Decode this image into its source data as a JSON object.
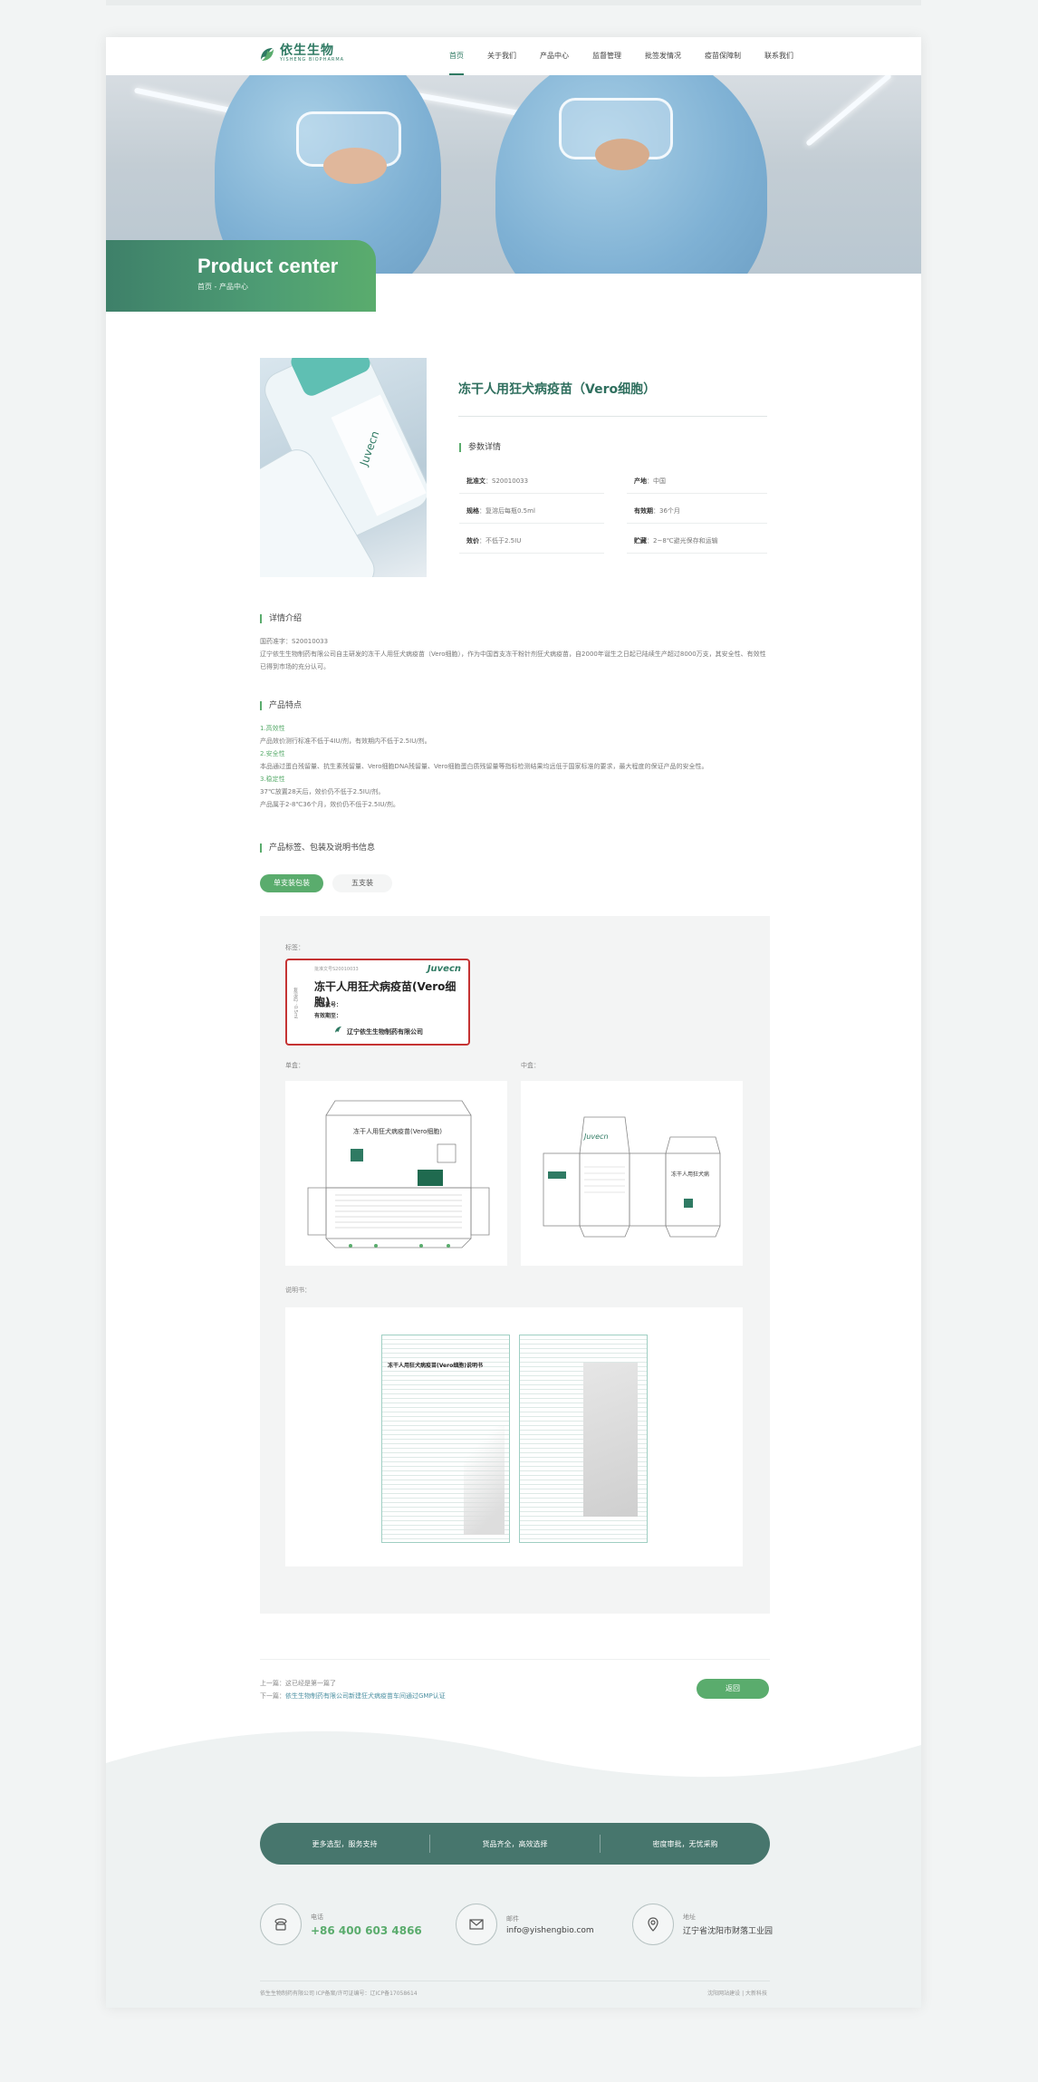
{
  "brand": {
    "name": "依生生物",
    "sub": "YISHENG BIOPHARMA"
  },
  "nav": [
    "首页",
    "关于我们",
    "产品中心",
    "监督管理",
    "批签发情况",
    "疫苗保障制",
    "联系我们"
  ],
  "banner": {
    "title": "Product center",
    "breadcrumb": "首页 - 产品中心"
  },
  "product": {
    "title": "冻干人用狂犬病疫苗（Vero细胞）",
    "params_heading": "参数详情",
    "specs": [
      {
        "label": "批准文",
        "value": "S20010033"
      },
      {
        "label": "产地",
        "value": "中国"
      },
      {
        "label": "规格",
        "value": "复溶后每瓶0.5ml"
      },
      {
        "label": "有效期",
        "value": "36个月"
      },
      {
        "label": "效价",
        "value": "不低于2.5IU"
      },
      {
        "label": "贮藏",
        "value": "2~8℃避光保存和运输"
      }
    ]
  },
  "detail": {
    "heading": "详情介绍",
    "lines": [
      "国药准字：S20010033",
      "辽宁依生生物制药有限公司自主研发的冻干人用狂犬病疫苗（Vero细胞），作为中国首支冻干粉针剂狂犬病疫苗，自2000年诞生之日起已陆续生产超过8000万支，其安全性、有效性已得到市场的充分认可。"
    ]
  },
  "features": {
    "heading": "产品特点",
    "lines": [
      "1.高效性",
      "产品效价测行标准不低于4IU/剂，有效期内不低于2.5IU/剂。",
      "2.安全性",
      "本品通过蛋白残留量、抗生素残留量、Vero细胞DNA残留量、Vero细胞蛋白质残留量等指标检测结果均远低于国家标准的要求，最大程度的保证产品的安全性。",
      "3.稳定性",
      "37℃放置28天后，效价仍不低于2.5IU/剂。",
      "产品属于2-8℃36个月，效价仍不低于2.5IU/剂。"
    ]
  },
  "packaging": {
    "heading": "产品标签、包装及说明书信息",
    "tabs": [
      "单支装包装",
      "五支装"
    ],
    "label_caption": "标签：",
    "single_box_caption": "单盒：",
    "mid_box_caption": "中盒：",
    "manual_caption": "说明书：",
    "label_card": {
      "approval": "批准文号S20010033",
      "name": "冻干人用狂犬病疫苗(Vero细胞)",
      "batch": "产品批号：",
      "expiry": "有效期至：",
      "company": "辽宁依生生物制药有限公司",
      "side": "复溶后：0.5ml",
      "logo": "Juvecn"
    },
    "manual_title": "冻干人用狂犬病疫苗(Vero细胞)说明书"
  },
  "pager": {
    "prev_label": "上一篇：",
    "prev_text": "这已经是第一篇了",
    "next_label": "下一篇：",
    "next_text": "依生生物制药有限公司新建狂犬病疫苗车间通过GMP认证",
    "back": "返回"
  },
  "footer": {
    "bar": [
      "更多选型，服务支持",
      "货品齐全，高效选择",
      "密度审批，无忧采购"
    ],
    "contacts": [
      {
        "icon": "phone-icon",
        "label": "电话",
        "value": "+86 400 603 4866"
      },
      {
        "icon": "mail-icon",
        "label": "邮件",
        "value": "info@yishengbio.com"
      },
      {
        "icon": "location-icon",
        "label": "地址",
        "value": "辽宁省沈阳市财落工业园"
      }
    ],
    "copyright": "依生生物制药有限公司   ICP备案/许可证编号：辽ICP备17058614",
    "right": "沈阳网站建设 | 大新科技"
  },
  "colors": {
    "brand_green": "#5aac6d",
    "brand_dark": "#2f6f5e",
    "footer_bar": "#47766d"
  }
}
